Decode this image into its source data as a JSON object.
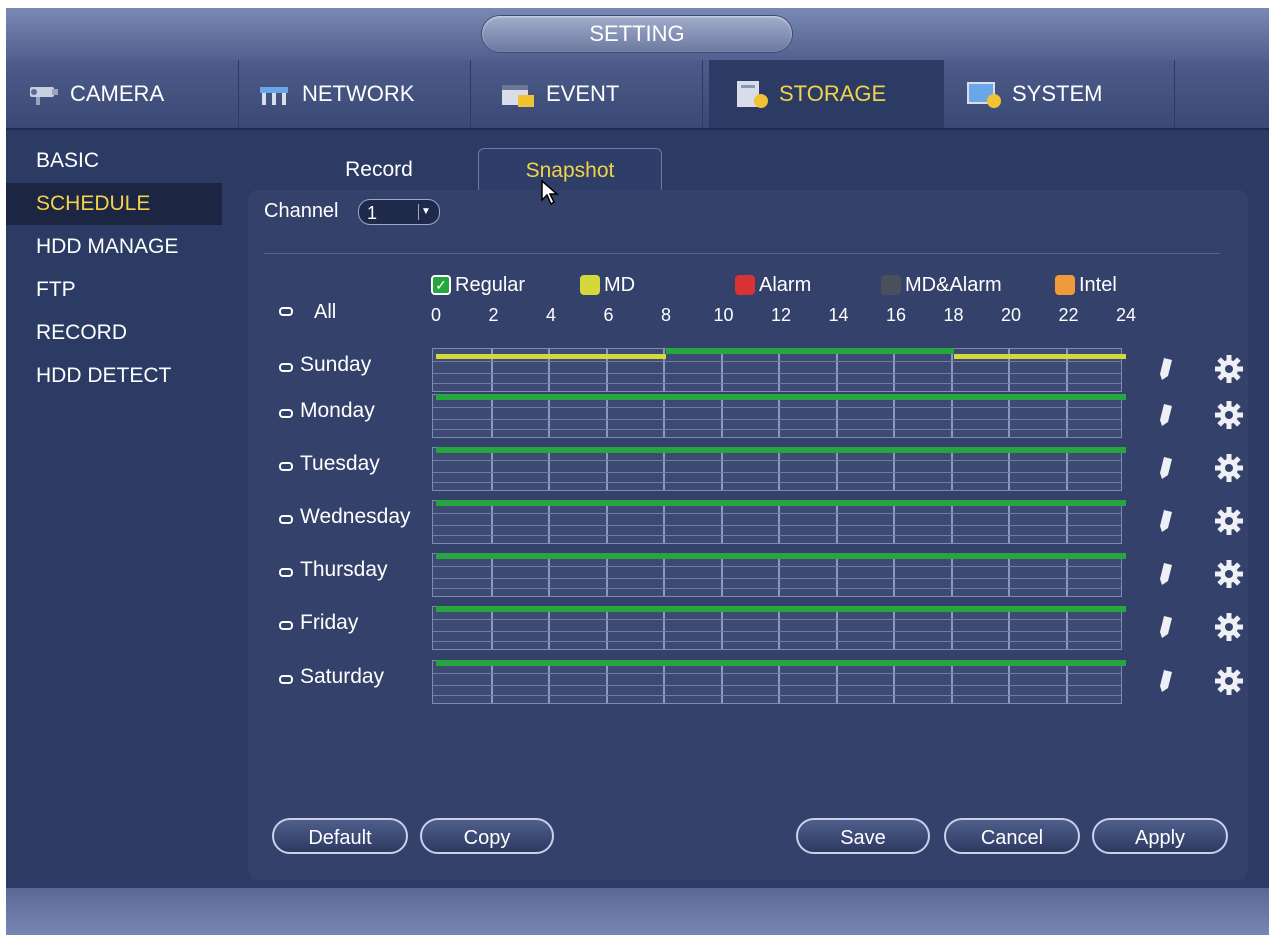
{
  "title": "SETTING",
  "top_tabs": [
    {
      "label": "CAMERA",
      "icon": "camera-icon"
    },
    {
      "label": "NETWORK",
      "icon": "network-icon"
    },
    {
      "label": "EVENT",
      "icon": "event-icon"
    },
    {
      "label": "STORAGE",
      "icon": "storage-icon",
      "active": true
    },
    {
      "label": "SYSTEM",
      "icon": "system-icon"
    }
  ],
  "left_menu": [
    {
      "label": "BASIC"
    },
    {
      "label": "SCHEDULE",
      "active": true
    },
    {
      "label": "HDD MANAGE"
    },
    {
      "label": "FTP"
    },
    {
      "label": "RECORD"
    },
    {
      "label": "HDD DETECT"
    }
  ],
  "sub_tabs": [
    {
      "label": "Record"
    },
    {
      "label": "Snapshot",
      "active": true
    }
  ],
  "channel": {
    "label": "Channel",
    "value": "1"
  },
  "legend": [
    {
      "label": "Regular",
      "color": "#27a53f",
      "checked": true
    },
    {
      "label": "MD",
      "color": "#d5d83b"
    },
    {
      "label": "Alarm",
      "color": "#d93232"
    },
    {
      "label": "MD&Alarm",
      "color": "#4a4f5c"
    },
    {
      "label": "Intel",
      "color": "#f19a3b"
    }
  ],
  "all_label": "All",
  "hours": [
    "0",
    "2",
    "4",
    "6",
    "8",
    "10",
    "12",
    "14",
    "16",
    "18",
    "20",
    "22",
    "24"
  ],
  "days": [
    {
      "label": "Sunday",
      "periods": [
        {
          "type": "md",
          "start": 0,
          "end": 8
        },
        {
          "type": "regular",
          "start": 8,
          "end": 18
        },
        {
          "type": "md",
          "start": 18,
          "end": 24
        }
      ]
    },
    {
      "label": "Monday",
      "periods": [
        {
          "type": "regular",
          "start": 0,
          "end": 24
        }
      ]
    },
    {
      "label": "Tuesday",
      "periods": [
        {
          "type": "regular",
          "start": 0,
          "end": 24
        }
      ]
    },
    {
      "label": "Wednesday",
      "periods": [
        {
          "type": "regular",
          "start": 0,
          "end": 24
        }
      ]
    },
    {
      "label": "Thursday",
      "periods": [
        {
          "type": "regular",
          "start": 0,
          "end": 24
        }
      ]
    },
    {
      "label": "Friday",
      "periods": [
        {
          "type": "regular",
          "start": 0,
          "end": 24
        }
      ]
    },
    {
      "label": "Saturday",
      "periods": [
        {
          "type": "regular",
          "start": 0,
          "end": 24
        }
      ]
    }
  ],
  "buttons": {
    "default": "Default",
    "copy": "Copy",
    "save": "Save",
    "cancel": "Cancel",
    "apply": "Apply"
  }
}
